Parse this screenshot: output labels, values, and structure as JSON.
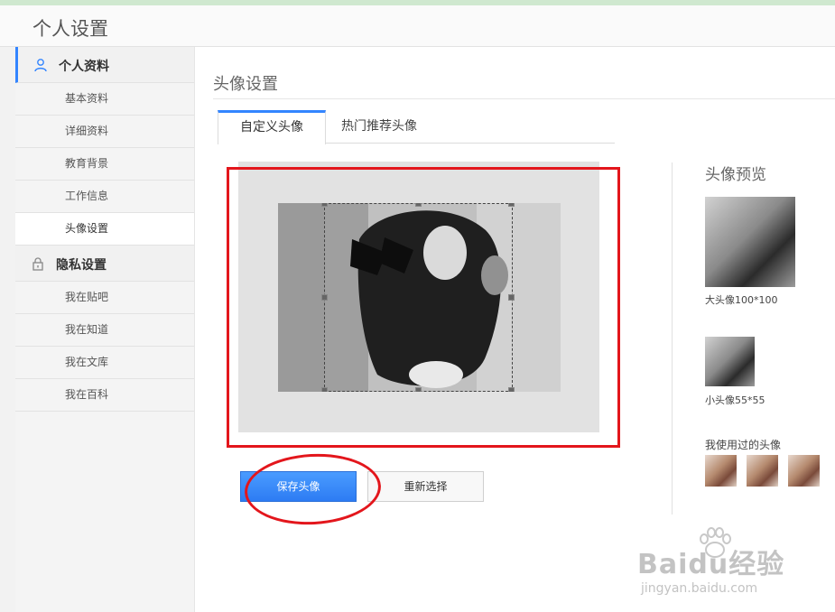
{
  "header": {
    "title": "个人设置"
  },
  "sidebar": {
    "groups": [
      {
        "label": "个人资料",
        "icon": "user-icon",
        "active": true,
        "items": [
          "基本资料",
          "详细资料",
          "教育背景",
          "工作信息",
          "头像设置"
        ]
      },
      {
        "label": "隐私设置",
        "icon": "lock-icon",
        "active": false,
        "items": [
          "我在贴吧",
          "我在知道",
          "我在文库",
          "我在百科"
        ]
      }
    ],
    "current_item": "头像设置"
  },
  "main": {
    "section_title": "头像设置",
    "tabs": [
      {
        "label": "自定义头像",
        "active": true
      },
      {
        "label": "热门推荐头像",
        "active": false
      }
    ],
    "buttons": {
      "save": "保存头像",
      "reselect": "重新选择"
    },
    "preview": {
      "title": "头像预览",
      "big_caption": "大头像100*100",
      "small_caption": "小头像55*55",
      "used_title": "我使用过的头像"
    }
  },
  "watermark": {
    "main": "Baidu经验",
    "sub": "jingyan.baidu.com"
  },
  "colors": {
    "accent": "#3385ff",
    "annotation": "#e3161c",
    "save_button": "#2d7cf3"
  }
}
